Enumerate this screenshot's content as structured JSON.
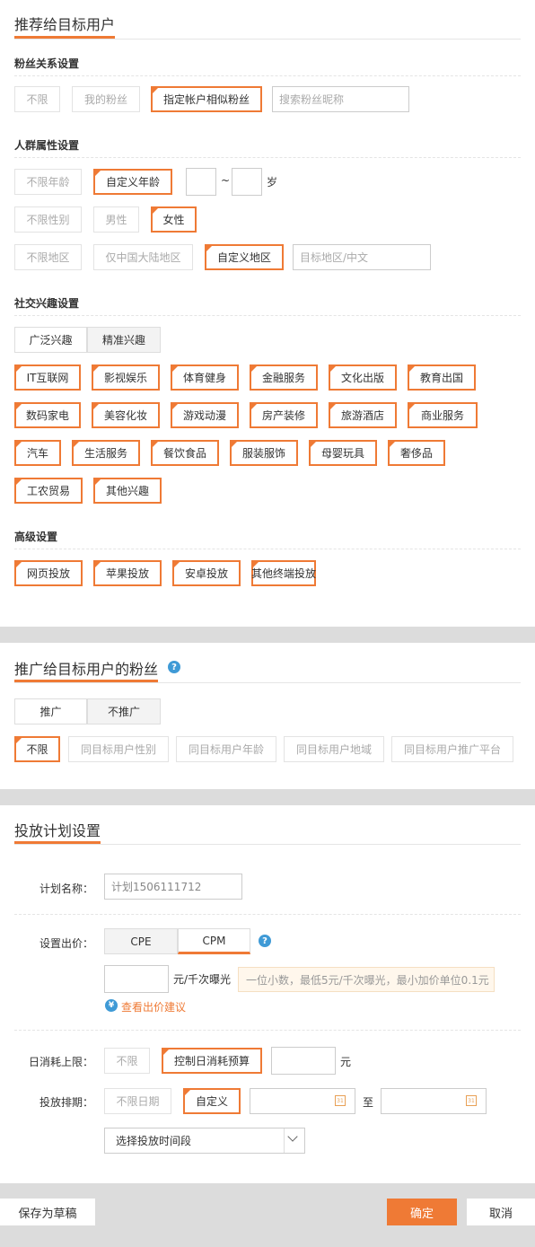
{
  "section1": {
    "title": "推荐给目标用户",
    "fans": {
      "label": "粉丝关系设置",
      "options": [
        "不限",
        "我的粉丝",
        "指定帐户相似粉丝"
      ],
      "search_placeholder": "搜索粉丝昵称"
    },
    "crowd": {
      "label": "人群属性设置",
      "age_options": [
        "不限年龄",
        "自定义年龄"
      ],
      "age_sep": "~",
      "age_unit": "岁",
      "gender_options": [
        "不限性别",
        "男性",
        "女性"
      ],
      "region_options": [
        "不限地区",
        "仅中国大陆地区",
        "自定义地区"
      ],
      "region_placeholder": "目标地区/中文"
    },
    "interest": {
      "label": "社交兴趣设置",
      "tabs": [
        "广泛兴趣",
        "精准兴趣"
      ],
      "tags": [
        "IT互联网",
        "影视娱乐",
        "体育健身",
        "金融服务",
        "文化出版",
        "教育出国",
        "数码家电",
        "美容化妆",
        "游戏动漫",
        "房产装修",
        "旅游酒店",
        "商业服务",
        "汽车",
        "生活服务",
        "餐饮食品",
        "服装服饰",
        "母婴玩具",
        "奢侈品",
        "工农贸易",
        "其他兴趣"
      ]
    },
    "advanced": {
      "label": "高级设置",
      "options": [
        "网页投放",
        "苹果投放",
        "安卓投放",
        "其他终端投放"
      ]
    }
  },
  "section2": {
    "title": "推广给目标用户的粉丝",
    "help_icon": "?",
    "tabs": [
      "推广",
      "不推广"
    ],
    "options": [
      "不限",
      "同目标用户性别",
      "同目标用户年龄",
      "同目标用户地域",
      "同目标用户推广平台"
    ]
  },
  "section3": {
    "title": "投放计划设置",
    "plan_name_label": "计划名称：",
    "plan_name_value": "计划1506111712",
    "bid_label": "设置出价：",
    "bid_tabs": [
      "CPE",
      "CPM"
    ],
    "bid_help": "?",
    "bid_unit": "元/千次曝光",
    "bid_hint": "一位小数，最低5元/千次曝光，最小加价单位0.1元",
    "advice_icon": "¥",
    "advice_link": "查看出价建议",
    "daily_label": "日消耗上限：",
    "daily_options": [
      "不限",
      "控制日消耗预算"
    ],
    "daily_unit": "元",
    "schedule_label": "投放排期：",
    "schedule_options": [
      "不限日期",
      "自定义"
    ],
    "date_sep": "至",
    "calendar_day": "31",
    "time_select": "选择投放时间段"
  },
  "footer": {
    "draft": "保存为草稿",
    "confirm": "确定",
    "cancel": "取消"
  },
  "colors": {
    "accent": "#ef7a35",
    "help": "#3f9ad6",
    "band": "#dcdcdc"
  }
}
